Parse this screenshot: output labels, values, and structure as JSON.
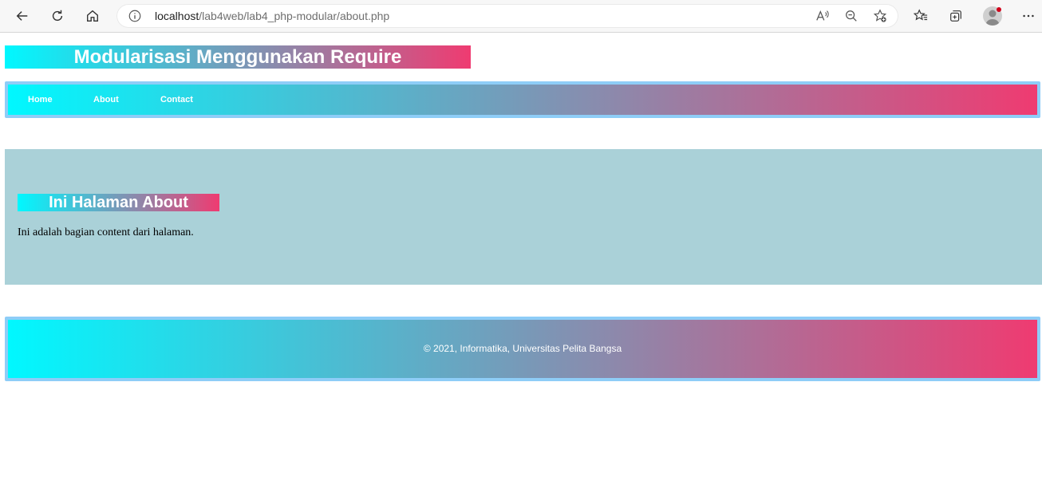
{
  "browser": {
    "url_host": "localhost",
    "url_path": "/lab4web/lab4_php-modular/about.php"
  },
  "site": {
    "title": "Modularisasi Menggunakan Require"
  },
  "nav": {
    "items": [
      {
        "label": "Home"
      },
      {
        "label": "About"
      },
      {
        "label": "Contact"
      }
    ]
  },
  "content": {
    "heading": "Ini Halaman About",
    "text": "Ini adalah bagian content dari halaman."
  },
  "footer": {
    "text": "© 2021, Informatika, Universitas Pelita Bangsa"
  },
  "colors": {
    "gradient_start": "#00f8ff",
    "gradient_end": "#ef3b71",
    "border": "#8ecdf7",
    "content_bg": "#aad1d8"
  }
}
